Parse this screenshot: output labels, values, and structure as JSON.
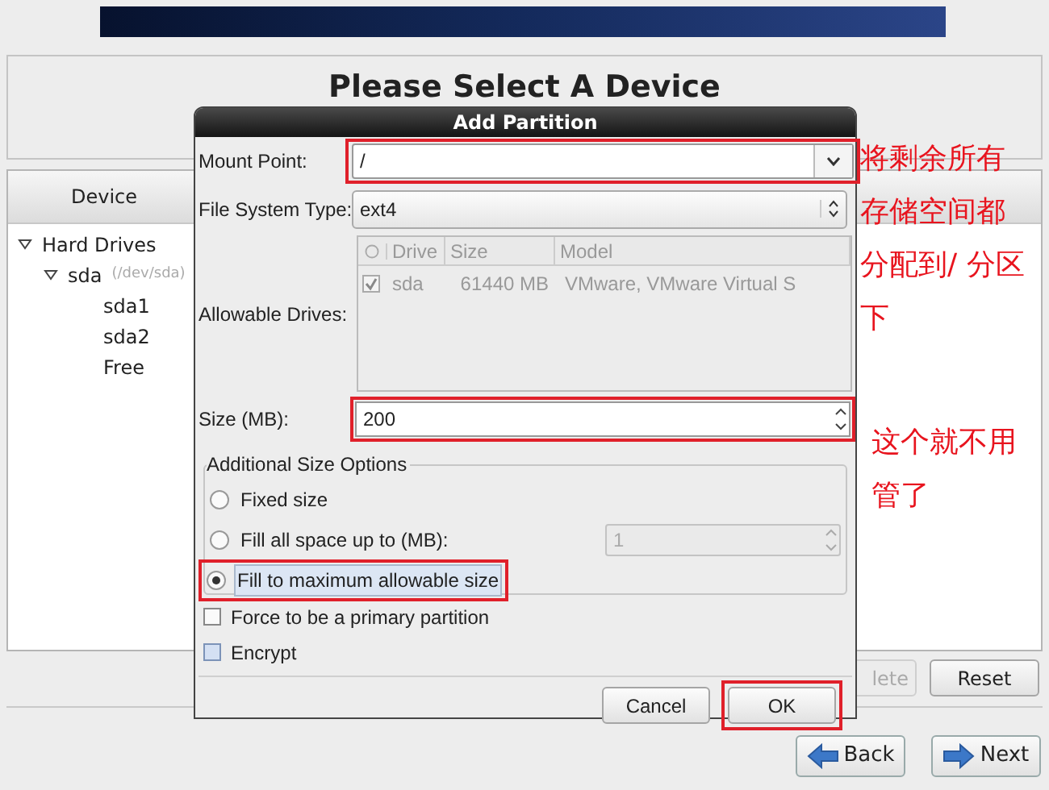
{
  "page_title": "Please Select A Device",
  "device_table": {
    "columns": [
      "Device"
    ],
    "tree": [
      {
        "label": "Hard Drives",
        "expanded": true,
        "children": [
          {
            "label": "sda",
            "detail": "(/dev/sda)",
            "expanded": true,
            "children": [
              {
                "label": "sda1"
              },
              {
                "label": "sda2"
              },
              {
                "label": "Free"
              }
            ]
          }
        ]
      }
    ]
  },
  "table_buttons": [
    {
      "label": "lete",
      "disabled": true
    },
    {
      "label": "Reset",
      "disabled": false
    }
  ],
  "nav_buttons": [
    {
      "label": "Back",
      "kind": "back"
    },
    {
      "label": "Next",
      "kind": "next"
    }
  ],
  "dialog": {
    "title": "Add Partition",
    "mount_point": {
      "label": "Mount Point:",
      "value": "/",
      "highlighted": true
    },
    "file_system_type": {
      "label": "File System Type:",
      "value": "ext4"
    },
    "allowable_drives": {
      "label": "Allowable Drives:",
      "columns": [
        "Drive",
        "Size",
        "Model"
      ],
      "rows": [
        {
          "checked": true,
          "drive": "sda",
          "size": "61440 MB",
          "model": "VMware, VMware Virtual S"
        }
      ]
    },
    "size": {
      "label": "Size (MB):",
      "value": "200",
      "highlighted": true
    },
    "size_options": {
      "title": "Additional Size Options",
      "options": [
        {
          "label": "Fixed size",
          "selected": false,
          "highlighted": false
        },
        {
          "label": "Fill all space up to (MB):",
          "selected": false,
          "highlighted": false,
          "spin_value": "1"
        },
        {
          "label": "Fill to maximum allowable size",
          "selected": true,
          "highlighted": true
        }
      ]
    },
    "checkboxes": [
      {
        "label": "Force to be a primary partition",
        "checked": false,
        "focused": false
      },
      {
        "label": "Encrypt",
        "checked": false,
        "focused": true
      }
    ],
    "buttons": [
      {
        "label": "Cancel",
        "highlighted": false
      },
      {
        "label": "OK",
        "highlighted": true
      }
    ]
  },
  "annotations": [
    {
      "lines": [
        "将剩余所有",
        "存储空间都",
        "分配到/ 分区",
        "下"
      ]
    },
    {
      "lines": [
        "这个就不用",
        "管了"
      ]
    }
  ]
}
